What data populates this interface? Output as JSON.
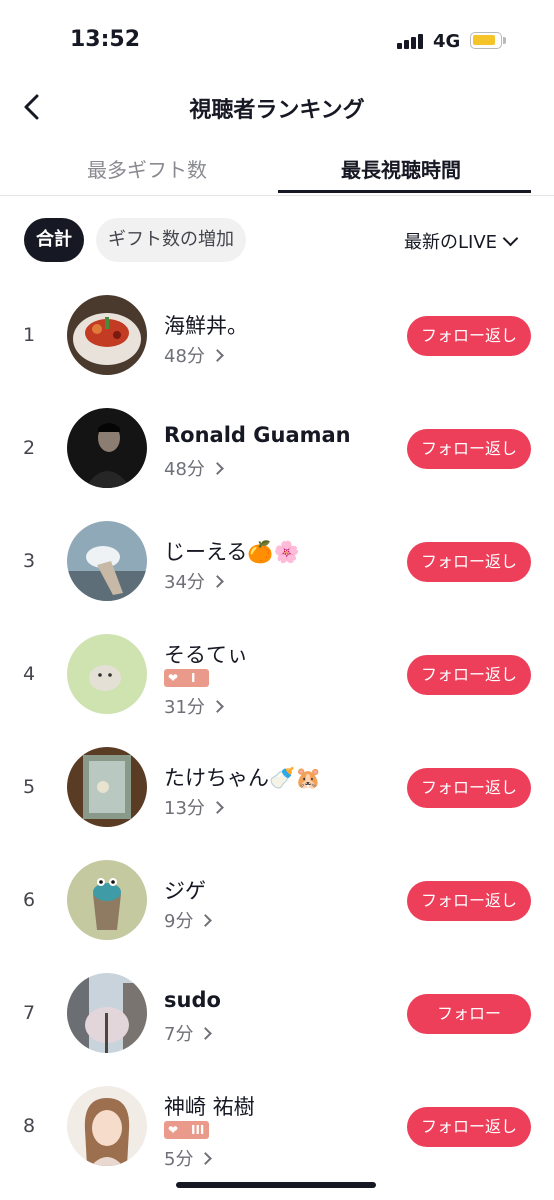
{
  "status": {
    "time": "13:52",
    "network": "4G"
  },
  "nav": {
    "title": "視聴者ランキング"
  },
  "tabs": [
    {
      "label": "最多ギフト数"
    },
    {
      "label": "最長視聴時間"
    }
  ],
  "filters": {
    "total": "合計",
    "gift_increase": "ギフト数の増加",
    "sort": "最新のLIVE"
  },
  "rows": [
    {
      "rank": "1",
      "name": "海鮮丼。",
      "duration": "48分",
      "button": "フォロー返し"
    },
    {
      "rank": "2",
      "name": "Ronald Guaman",
      "duration": "48分",
      "button": "フォロー返し"
    },
    {
      "rank": "3",
      "name": "じーえる🍊🌸",
      "duration": "34分",
      "button": "フォロー返し"
    },
    {
      "rank": "4",
      "name": "そるてぃ",
      "badge": "I",
      "duration": "31分",
      "button": "フォロー返し"
    },
    {
      "rank": "5",
      "name": "たけちゃん🍼🐹",
      "duration": "13分",
      "button": "フォロー返し"
    },
    {
      "rank": "6",
      "name": "ジゲ",
      "duration": "9分",
      "button": "フォロー返し"
    },
    {
      "rank": "7",
      "name": "sudo",
      "duration": "7分",
      "button": "フォロー"
    },
    {
      "rank": "8",
      "name": "神崎 祐樹",
      "badge": "III",
      "duration": "5分",
      "button": "フォロー返し"
    }
  ],
  "colors": {
    "accent": "#ee3f5a",
    "badge": "#e99a8a",
    "text": "#161823"
  }
}
